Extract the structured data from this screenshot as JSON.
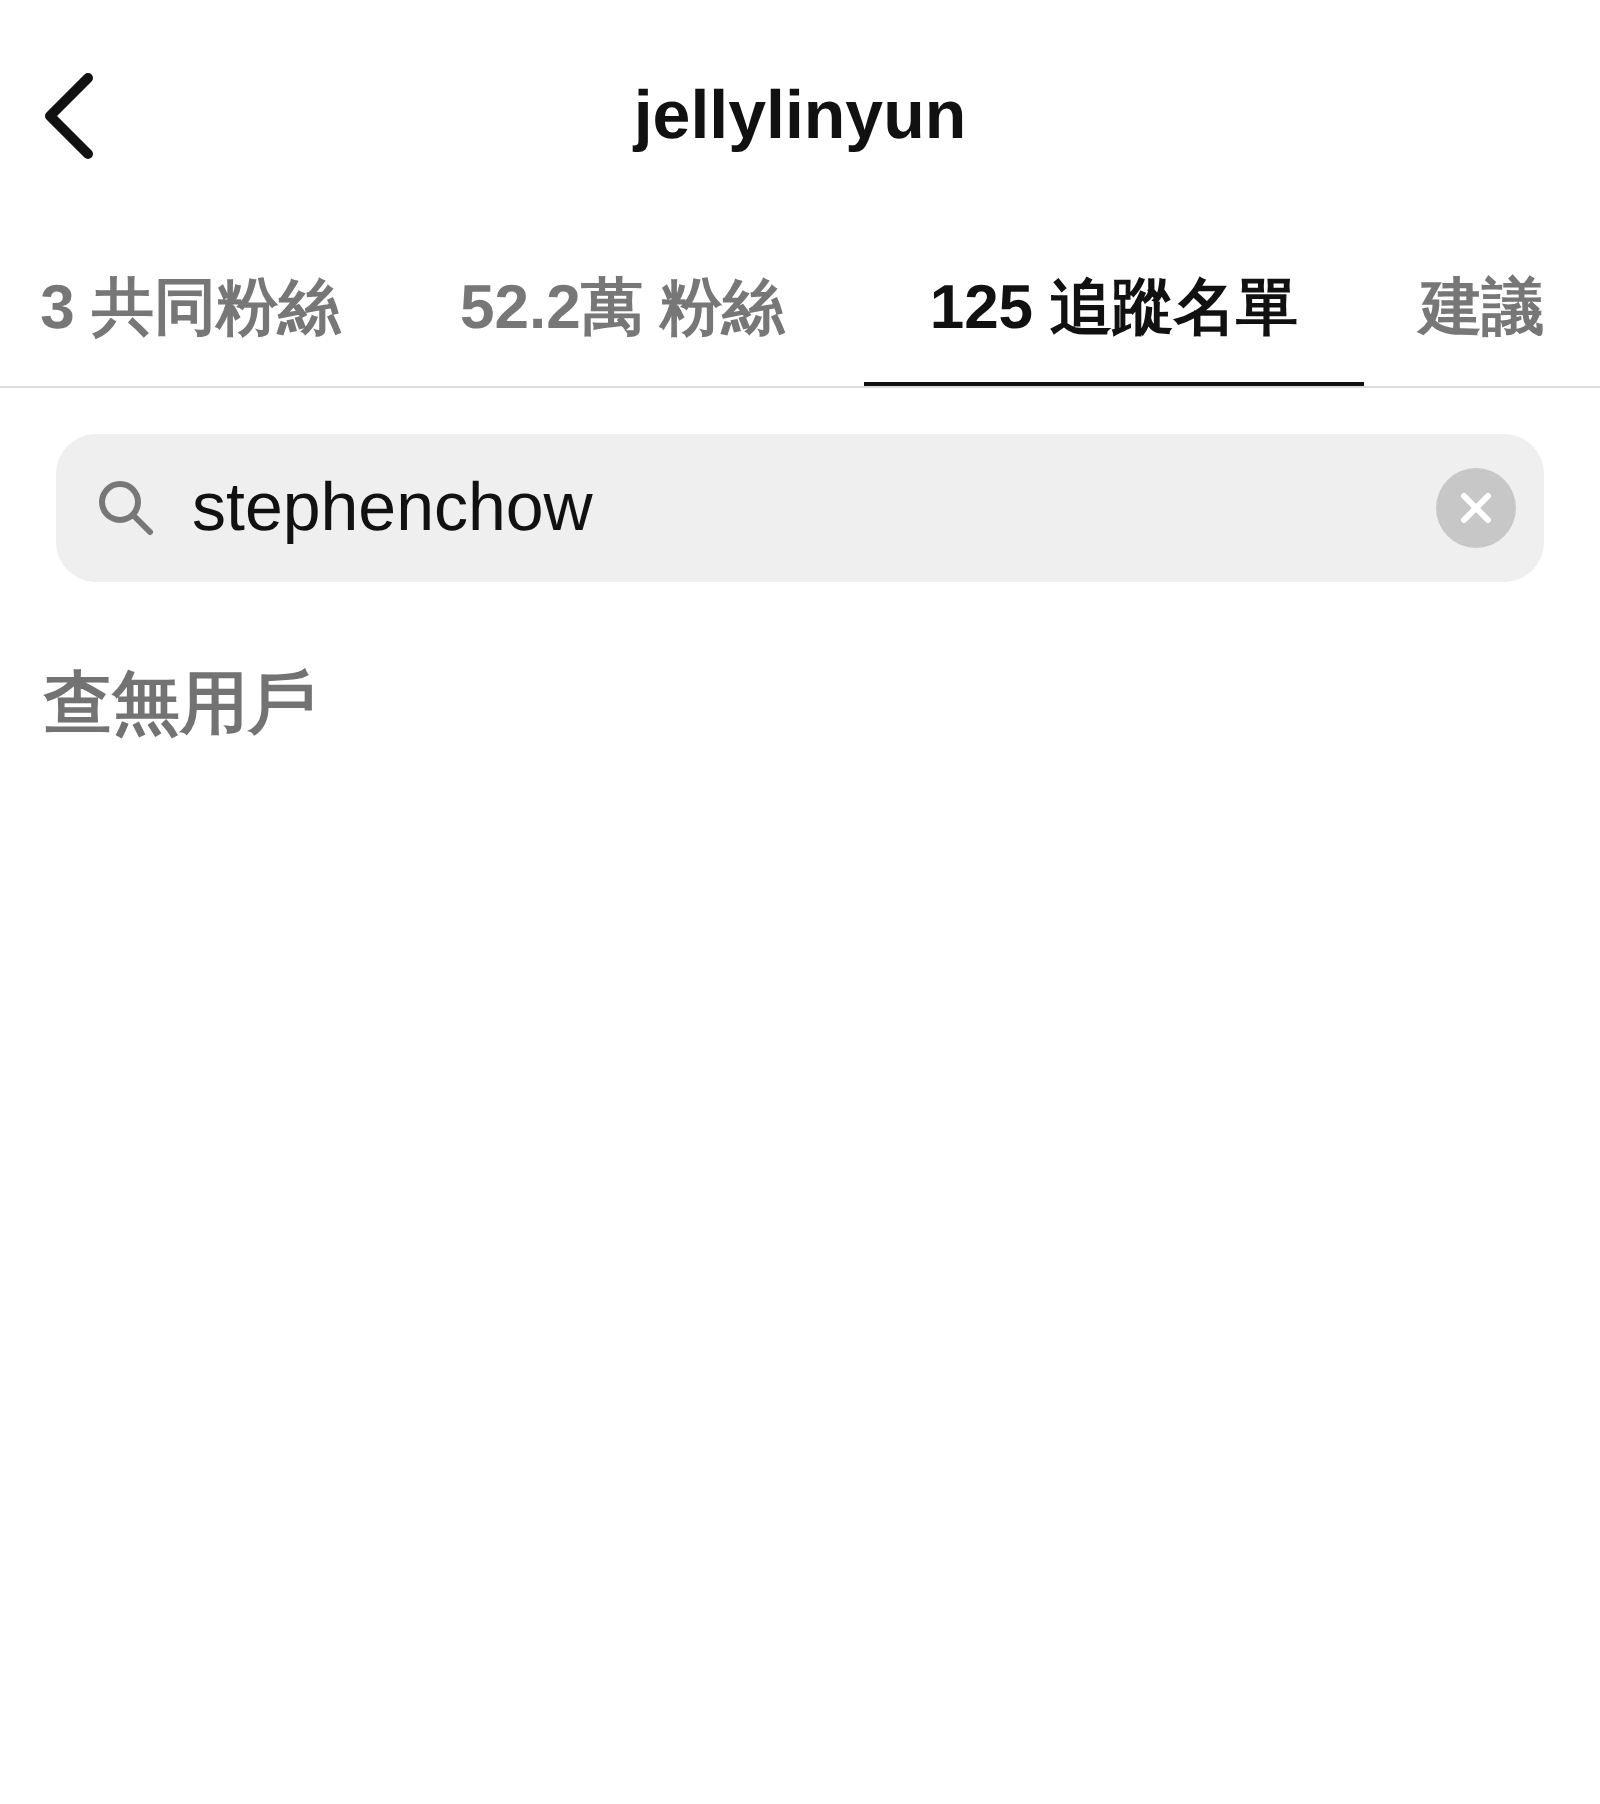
{
  "header": {
    "title": "jellylinyun"
  },
  "tabs": [
    {
      "label": "3 共同粉絲",
      "selected": false
    },
    {
      "label": "52.2萬 粉絲",
      "selected": false
    },
    {
      "label": "125 追蹤名單",
      "selected": true
    },
    {
      "label": "建議",
      "selected": false
    }
  ],
  "search": {
    "value": "stephenchow"
  },
  "empty_message": "查無用戶"
}
